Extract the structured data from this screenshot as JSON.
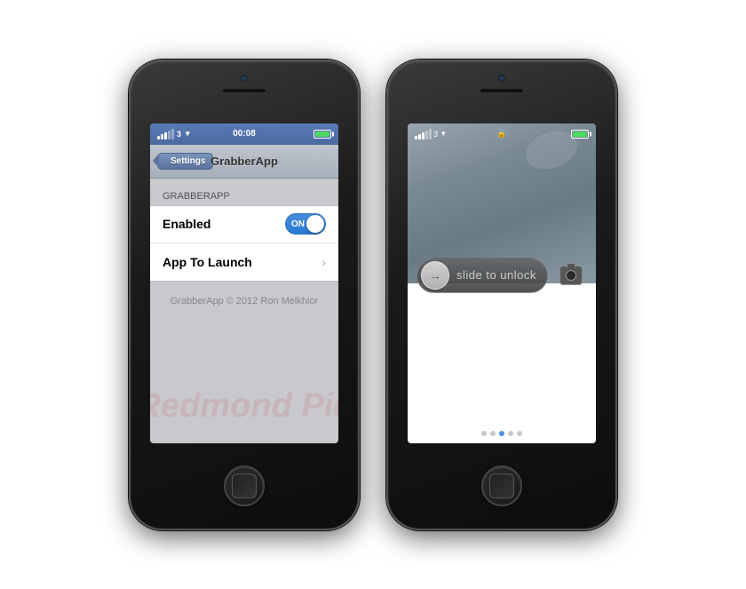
{
  "phone1": {
    "status_bar": {
      "signal": "3",
      "time": "00:08",
      "battery_label": ""
    },
    "nav": {
      "back_label": "Settings",
      "title": "GrabberApp"
    },
    "table": {
      "group_header": "GrabberApp",
      "rows": [
        {
          "label": "Enabled",
          "type": "toggle",
          "toggle_on_label": "ON"
        },
        {
          "label": "App To Launch",
          "type": "disclosure"
        }
      ]
    },
    "footer": "GrabberApp © 2012 Ron Melkhior"
  },
  "phone2": {
    "status_bar": {
      "signal": "3",
      "wifi": true,
      "lock_icon": "🔒"
    },
    "slide_to_unlock": "slide to unlock",
    "pagination": {
      "total": 5,
      "active_index": 2
    }
  },
  "watermark": "Redmond Pie"
}
